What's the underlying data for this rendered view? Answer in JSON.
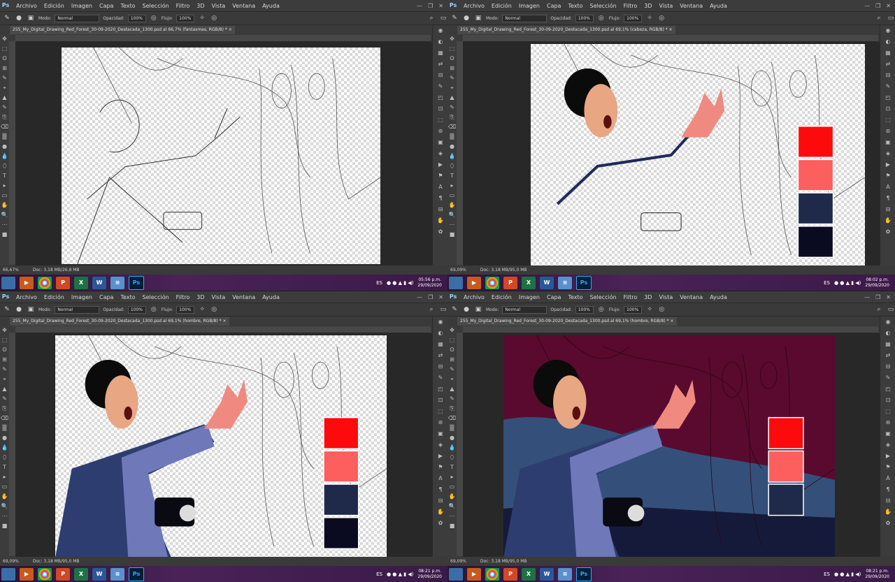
{
  "menu": [
    "Archivo",
    "Edición",
    "Imagen",
    "Capa",
    "Texto",
    "Selección",
    "Filtro",
    "3D",
    "Vista",
    "Ventana",
    "Ayuda"
  ],
  "options": {
    "mode_label": "Modo:",
    "mode_value": "Normal",
    "opacity_label": "Opacidad:",
    "opacity_value": "100%",
    "flow_label": "Flujo:",
    "flow_value": "100%"
  },
  "palette": [
    "#fd0a0d",
    "#fd5e5e",
    "#1f2a4a",
    "#0a0a20"
  ],
  "panes": [
    {
      "tab": "255_My_Digital_Drawing_Red_Forest_30-09-2020_Destacada_1300.psd al 66,7% (fantasmas, RGB/8) *",
      "zoom": "66,67%",
      "doc": "Doc: 3,18 MB/26,8 MB",
      "time": "05:56 p.m.",
      "date": "29/09/2020",
      "lang": "ES"
    },
    {
      "tab": "255_My_Digital_Drawing_Red_Forest_30-09-2020_Destacada_1300.psd al 69,1% (cabeza, RGB/8) *",
      "zoom": "69,09%",
      "doc": "Doc: 3,18 MB/95,0 MB",
      "time": "08:02 p.m.",
      "date": "29/09/2020",
      "lang": "ES"
    },
    {
      "tab": "255_My_Digital_Drawing_Red_Forest_30-09-2020_Destacada_1300.psd al 69,1% (hombre, RGB/8) *",
      "zoom": "69,09%",
      "doc": "Doc: 3,18 MB/95,0 MB",
      "time": "08:21 p.m.",
      "date": "29/09/2020",
      "lang": "ES"
    },
    {
      "tab": "255_My_Digital_Drawing_Red_Forest_30-09-2020_Destacada_1300.psd al 69,1% (hombre, RGB/8) *",
      "zoom": "69,09%",
      "doc": "Doc: 3,18 MB/95,0 MB",
      "time": "08:21 p.m.",
      "date": "29/09/2020",
      "lang": "ES"
    }
  ],
  "taskbar_apps": [
    "explorer-icon",
    "media-player-icon",
    "chrome-icon",
    "powerpoint-icon",
    "excel-icon",
    "word-icon",
    "notepad-icon",
    "photoshop-icon"
  ],
  "taskbar_labels": {
    "powerpoint": "P",
    "excel": "X",
    "word": "W",
    "photoshop": "Ps"
  }
}
